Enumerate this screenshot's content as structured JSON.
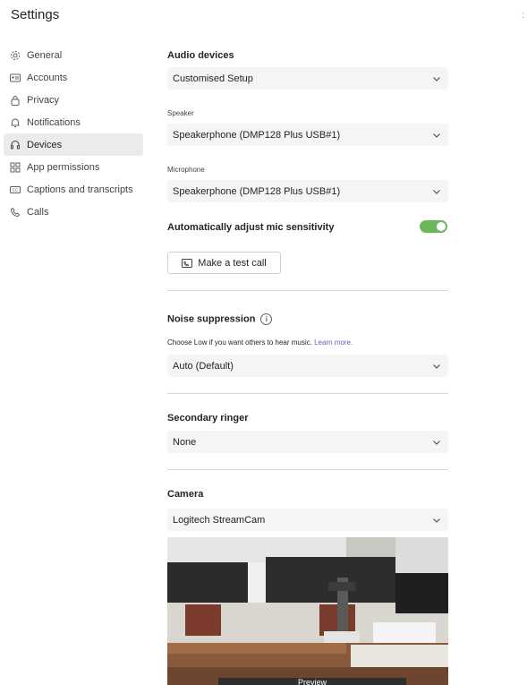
{
  "header": {
    "title": "Settings"
  },
  "sidebar": {
    "items": [
      {
        "label": "General",
        "icon": "gear-icon"
      },
      {
        "label": "Accounts",
        "icon": "id-card-icon"
      },
      {
        "label": "Privacy",
        "icon": "lock-icon"
      },
      {
        "label": "Notifications",
        "icon": "bell-icon"
      },
      {
        "label": "Devices",
        "icon": "headset-icon",
        "active": true
      },
      {
        "label": "App permissions",
        "icon": "grid-icon"
      },
      {
        "label": "Captions and transcripts",
        "icon": "cc-icon"
      },
      {
        "label": "Calls",
        "icon": "phone-icon"
      }
    ]
  },
  "audio": {
    "title": "Audio devices",
    "setup_value": "Customised Setup",
    "speaker_label": "Speaker",
    "speaker_value": "Speakerphone (DMP128 Plus USB#1)",
    "mic_label": "Microphone",
    "mic_value": "Speakerphone (DMP128 Plus USB#1)",
    "auto_adjust_label": "Automatically adjust mic sensitivity",
    "auto_adjust_on": true,
    "test_call_label": "Make a test call"
  },
  "noise": {
    "title": "Noise suppression",
    "info_icon": "info-icon",
    "hint": "Choose Low if you want others to hear music.",
    "learn_more": "Learn more.",
    "value": "Auto (Default)"
  },
  "ringer": {
    "title": "Secondary ringer",
    "value": "None"
  },
  "camera": {
    "title": "Camera",
    "value": "Logitech StreamCam",
    "preview_label": "Preview"
  },
  "colors": {
    "toggle_on": "#6bb75a",
    "link": "#5b5fc7",
    "active_nav": "#ebebeb"
  }
}
